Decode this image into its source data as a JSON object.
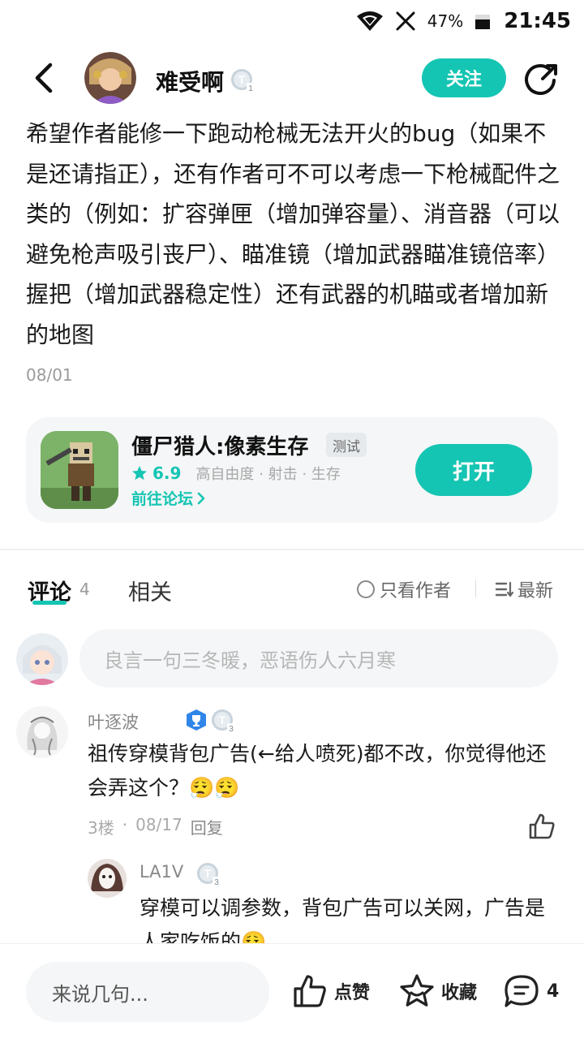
{
  "status_bar": {
    "battery_percent": "47%",
    "time": "21:45"
  },
  "header": {
    "author_name": "难受啊",
    "author_level": "1",
    "follow_label": "关注"
  },
  "post": {
    "content": "希望作者能修一下跑动枪械无法开火的bug（如果不是还请指正），还有作者可不可以考虑一下枪械配件之类的（例如：扩容弹匣（增加弹容量）、消音器（可以避免枪声吸引丧尸）、瞄准镜（增加武器瞄准镜倍率）握把（增加武器稳定性）还有武器的机瞄或者增加新的地图",
    "date": "08/01"
  },
  "game_card": {
    "title": "僵尸猎人:像素生存",
    "tag": "测试",
    "rating": "6.9",
    "genres": "高自由度 · 射击 · 生存",
    "forum_link": "前往论坛",
    "open_label": "打开"
  },
  "tabs": {
    "comments_label": "评论",
    "comments_count": "4",
    "related_label": "相关",
    "author_only_label": "只看作者",
    "sort_label": "最新"
  },
  "comment_input": {
    "placeholder": "良言一句三冬暖，恶语伤人六月寒"
  },
  "comments": [
    {
      "name": "叶逐波",
      "level": "3",
      "text": "祖传穿模背包广告(←给人喷死)都不改，你觉得他还会弄这个？😮‍💨😮‍💨",
      "floor": "3楼",
      "date": "08/17",
      "reply_label": "回复",
      "reply": {
        "name": "LA1V",
        "level": "3",
        "text": "穿模可以调参数，背包广告可以关网，广告是人家吃饭的😮‍💨"
      }
    }
  ],
  "bottom_bar": {
    "input_placeholder": "来说几句...",
    "like_label": "点赞",
    "favorite_label": "收藏",
    "comment_count": "4"
  },
  "colors": {
    "accent": "#15c5b3",
    "text": "#1a1a1a",
    "muted": "#9a9a9a",
    "card_bg": "#f4f6f7"
  }
}
